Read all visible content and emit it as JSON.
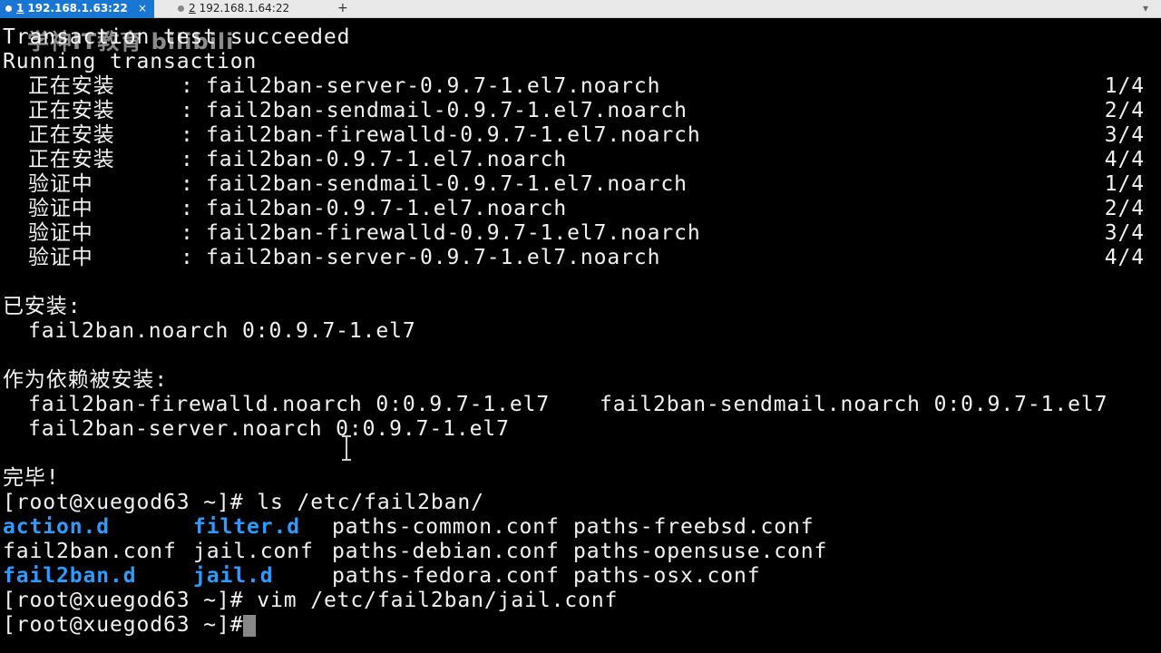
{
  "tabs": [
    {
      "num": "1",
      "host": "192.168.1.63:22",
      "active": true
    },
    {
      "num": "2",
      "host": "192.168.1.64:22",
      "active": false
    }
  ],
  "tab_add": "+",
  "tab_close": "×",
  "watermark": "学神IT教育 bilibili",
  "terminal": {
    "header_lines": [
      "Transaction test succeeded",
      "Running transaction"
    ],
    "install_rows": [
      {
        "action": "正在安装",
        "pkg": "fail2ban-server-0.9.7-1.el7.noarch",
        "progress": "1/4"
      },
      {
        "action": "正在安装",
        "pkg": "fail2ban-sendmail-0.9.7-1.el7.noarch",
        "progress": "2/4"
      },
      {
        "action": "正在安装",
        "pkg": "fail2ban-firewalld-0.9.7-1.el7.noarch",
        "progress": "3/4"
      },
      {
        "action": "正在安装",
        "pkg": "fail2ban-0.9.7-1.el7.noarch",
        "progress": "4/4"
      },
      {
        "action": "验证中",
        "pkg": "fail2ban-sendmail-0.9.7-1.el7.noarch",
        "progress": "1/4"
      },
      {
        "action": "验证中",
        "pkg": "fail2ban-0.9.7-1.el7.noarch",
        "progress": "2/4"
      },
      {
        "action": "验证中",
        "pkg": "fail2ban-firewalld-0.9.7-1.el7.noarch",
        "progress": "3/4"
      },
      {
        "action": "验证中",
        "pkg": "fail2ban-server-0.9.7-1.el7.noarch",
        "progress": "4/4"
      }
    ],
    "installed_title": "已安装:",
    "installed_pkg": "fail2ban.noarch 0:0.9.7-1.el7",
    "deps_title": "作为依赖被安装:",
    "deps": [
      "fail2ban-firewalld.noarch 0:0.9.7-1.el7",
      "fail2ban-sendmail.noarch 0:0.9.7-1.el7",
      "fail2ban-server.noarch 0:0.9.7-1.el7"
    ],
    "done": "完毕!",
    "prompt": "[root@xuegod63 ~]# ",
    "cmd_ls": "ls /etc/fail2ban/",
    "ls_rows": [
      [
        "action.d",
        "filter.d",
        "paths-common.conf",
        "paths-freebsd.conf"
      ],
      [
        "fail2ban.conf",
        "jail.conf",
        "paths-debian.conf",
        "paths-opensuse.conf"
      ],
      [
        "fail2ban.d",
        "jail.d",
        "paths-fedora.conf",
        "paths-osx.conf"
      ]
    ],
    "cmd_vim": "vim /etc/fail2ban/jail.conf",
    "colors": {
      "directory": "#2e9bff",
      "text": "#f2f2f2",
      "background": "#000000"
    }
  }
}
